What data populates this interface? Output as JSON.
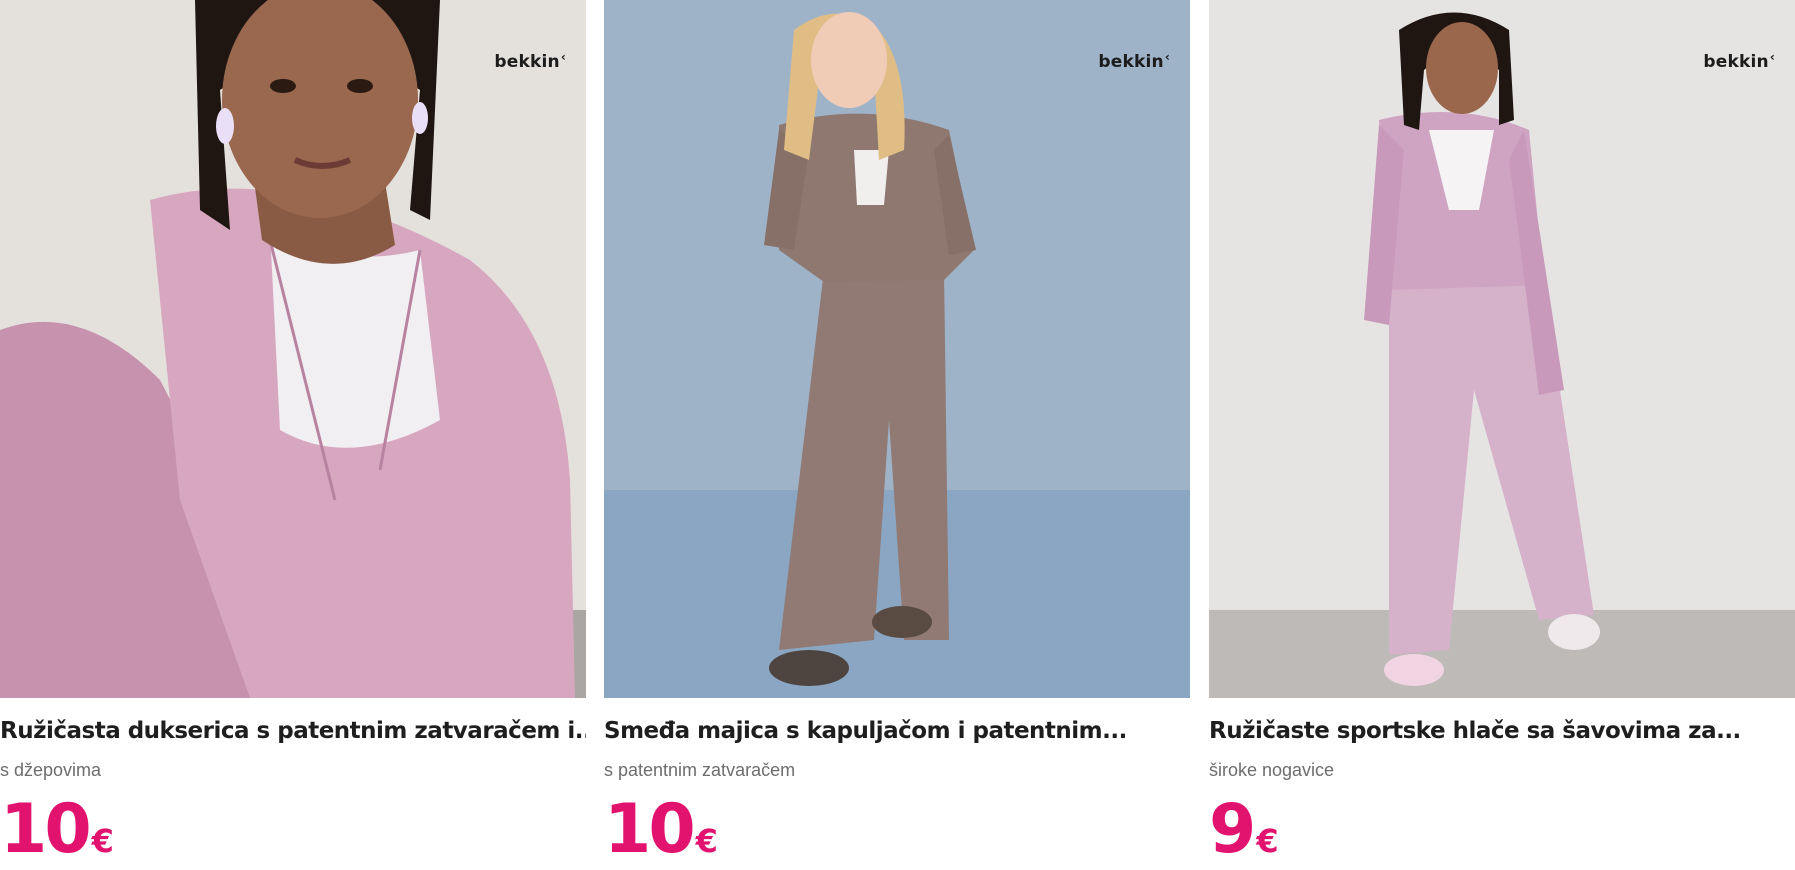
{
  "brand": {
    "name": "bekkin",
    "mark": "‹"
  },
  "colors": {
    "price": "#e2136e",
    "title": "#1e1e1e",
    "subtitle": "#6d6d6d"
  },
  "products": [
    {
      "image_alt": "Ružičasta dukserica s patentnim zatvaračem",
      "title": "Ružičasta dukserica s patentnim zatvaračem i...",
      "subtitle": "s džepovima",
      "price": "10",
      "currency": "€"
    },
    {
      "image_alt": "Smeđa majica s kapuljačom",
      "title": "Smeđa majica s kapuljačom i patentnim...",
      "subtitle": "s patentnim zatvaračem",
      "price": "10",
      "currency": "€"
    },
    {
      "image_alt": "Ružičaste sportske hlače",
      "title": "Ružičaste sportske hlače sa šavovima za...",
      "subtitle": "široke nogavice",
      "price": "9",
      "currency": "€"
    }
  ]
}
